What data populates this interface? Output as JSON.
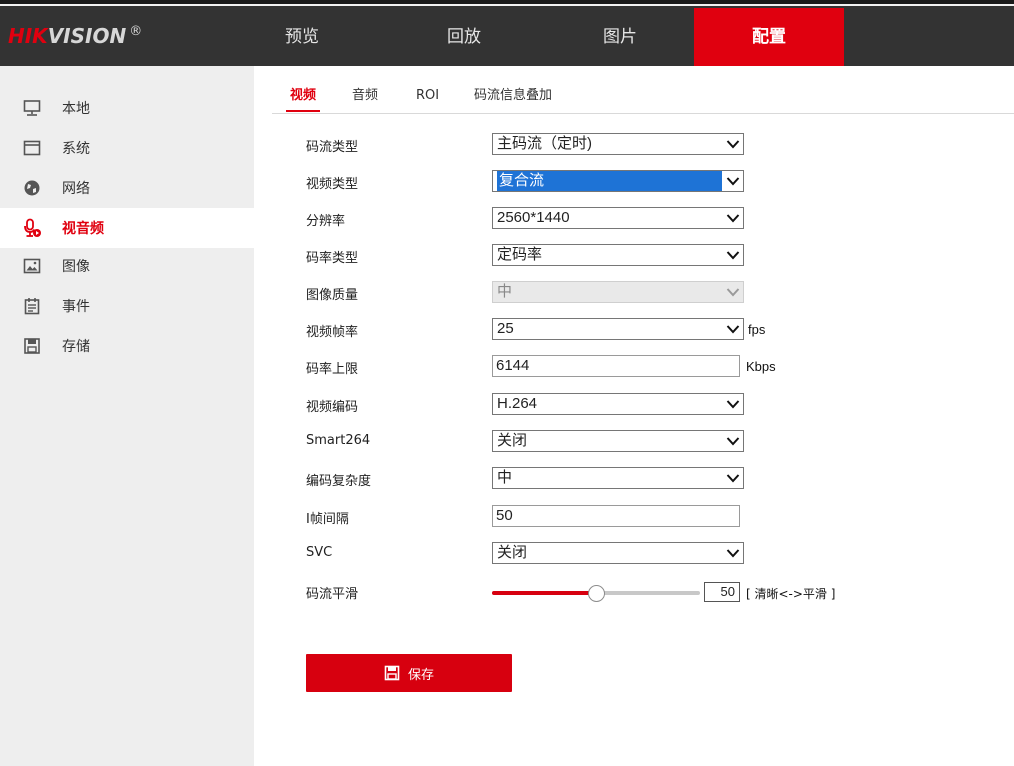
{
  "brand": {
    "hik": "HIK",
    "vision": "VISION",
    "reg": "®"
  },
  "nav": {
    "items": [
      {
        "label": "预览"
      },
      {
        "label": "回放"
      },
      {
        "label": "图片"
      },
      {
        "label": "配置"
      }
    ],
    "active_index": 3,
    "accent_color": "#e0000f"
  },
  "sidebar": {
    "items": [
      {
        "label": "本地",
        "icon": "monitor-icon"
      },
      {
        "label": "系统",
        "icon": "window-icon"
      },
      {
        "label": "网络",
        "icon": "globe-icon"
      },
      {
        "label": "视音频",
        "icon": "microphone-icon"
      },
      {
        "label": "图像",
        "icon": "image-icon"
      },
      {
        "label": "事件",
        "icon": "calendar-icon"
      },
      {
        "label": "存储",
        "icon": "floppy-icon"
      }
    ],
    "active_index": 3
  },
  "tabs": {
    "items": [
      {
        "label": "视频"
      },
      {
        "label": "音频"
      },
      {
        "label": "ROI"
      },
      {
        "label": "码流信息叠加"
      }
    ],
    "active_index": 0
  },
  "form": {
    "stream_type": {
      "label": "码流类型",
      "value": "主码流（定时)"
    },
    "video_type": {
      "label": "视频类型",
      "value": "复合流"
    },
    "resolution": {
      "label": "分辨率",
      "value": "2560*1440"
    },
    "bitrate_type": {
      "label": "码率类型",
      "value": "定码率"
    },
    "image_quality": {
      "label": "图像质量",
      "value": "中"
    },
    "frame_rate": {
      "label": "视频帧率",
      "value": "25",
      "unit": "fps"
    },
    "max_bitrate": {
      "label": "码率上限",
      "value": "6144",
      "unit": "Kbps"
    },
    "video_encoding": {
      "label": "视频编码",
      "value": "H.264"
    },
    "smart264": {
      "label": "Smart264",
      "value": "关闭"
    },
    "encoding_complexity": {
      "label": "编码复杂度",
      "value": "中"
    },
    "i_frame_interval": {
      "label": "I帧间隔",
      "value": "50"
    },
    "svc": {
      "label": "SVC",
      "value": "关闭"
    },
    "smoothing": {
      "label": "码流平滑",
      "value": "50",
      "fraction": 0.5,
      "range_text": "[ 清晰<->平滑 ]"
    }
  },
  "save_button": {
    "label": "保存",
    "icon": "floppy-icon"
  }
}
